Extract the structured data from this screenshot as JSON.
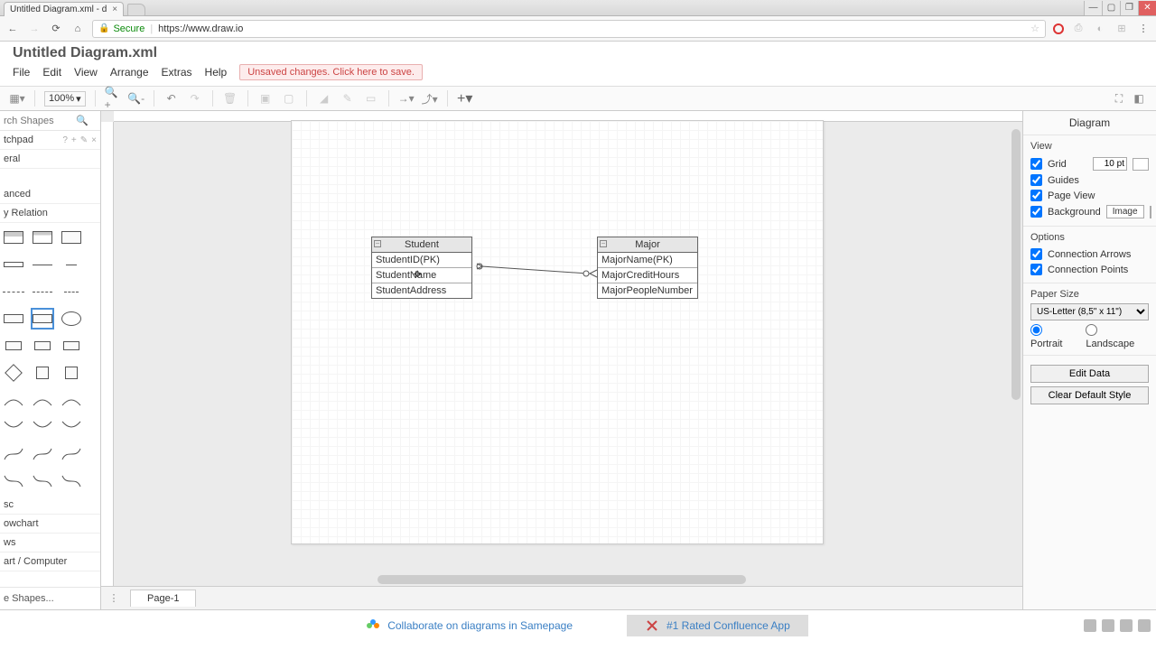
{
  "browser": {
    "tab_title": "Untitled Diagram.xml - d",
    "secure_label": "Secure",
    "url": "https://www.draw.io"
  },
  "app": {
    "title": "Untitled Diagram.xml",
    "menus": [
      "File",
      "Edit",
      "View",
      "Arrange",
      "Extras",
      "Help"
    ],
    "unsaved": "Unsaved changes. Click here to save."
  },
  "toolbar": {
    "zoom": "100%"
  },
  "left_panel": {
    "search_placeholder": "rch Shapes",
    "scratchpad": "tchpad",
    "sections": [
      "eral",
      "anced",
      "y Relation",
      "sc",
      "owchart",
      "ws",
      "art / Computer"
    ],
    "more": "e Shapes..."
  },
  "canvas": {
    "entity1": {
      "title": "Student",
      "rows": [
        "StudentID(PK)",
        "StudentName",
        "StudentAddress"
      ]
    },
    "entity2": {
      "title": "Major",
      "rows": [
        "MajorName(PK)",
        "MajorCreditHours",
        "MajorPeopleNumber"
      ]
    }
  },
  "right_panel": {
    "title": "Diagram",
    "view": {
      "head": "View",
      "grid": "Grid",
      "grid_size": "10 pt",
      "guides": "Guides",
      "page_view": "Page View",
      "background": "Background",
      "image_btn": "Image"
    },
    "options": {
      "head": "Options",
      "conn_arrows": "Connection Arrows",
      "conn_points": "Connection Points"
    },
    "paper": {
      "head": "Paper Size",
      "size": "US-Letter (8,5\" x 11\")",
      "portrait": "Portrait",
      "landscape": "Landscape"
    },
    "buttons": {
      "edit_data": "Edit Data",
      "clear_style": "Clear Default Style"
    }
  },
  "page_tabs": {
    "page1": "Page-1"
  },
  "footer": {
    "ad1": "Collaborate on diagrams in Samepage",
    "ad2": "#1 Rated Confluence App"
  }
}
